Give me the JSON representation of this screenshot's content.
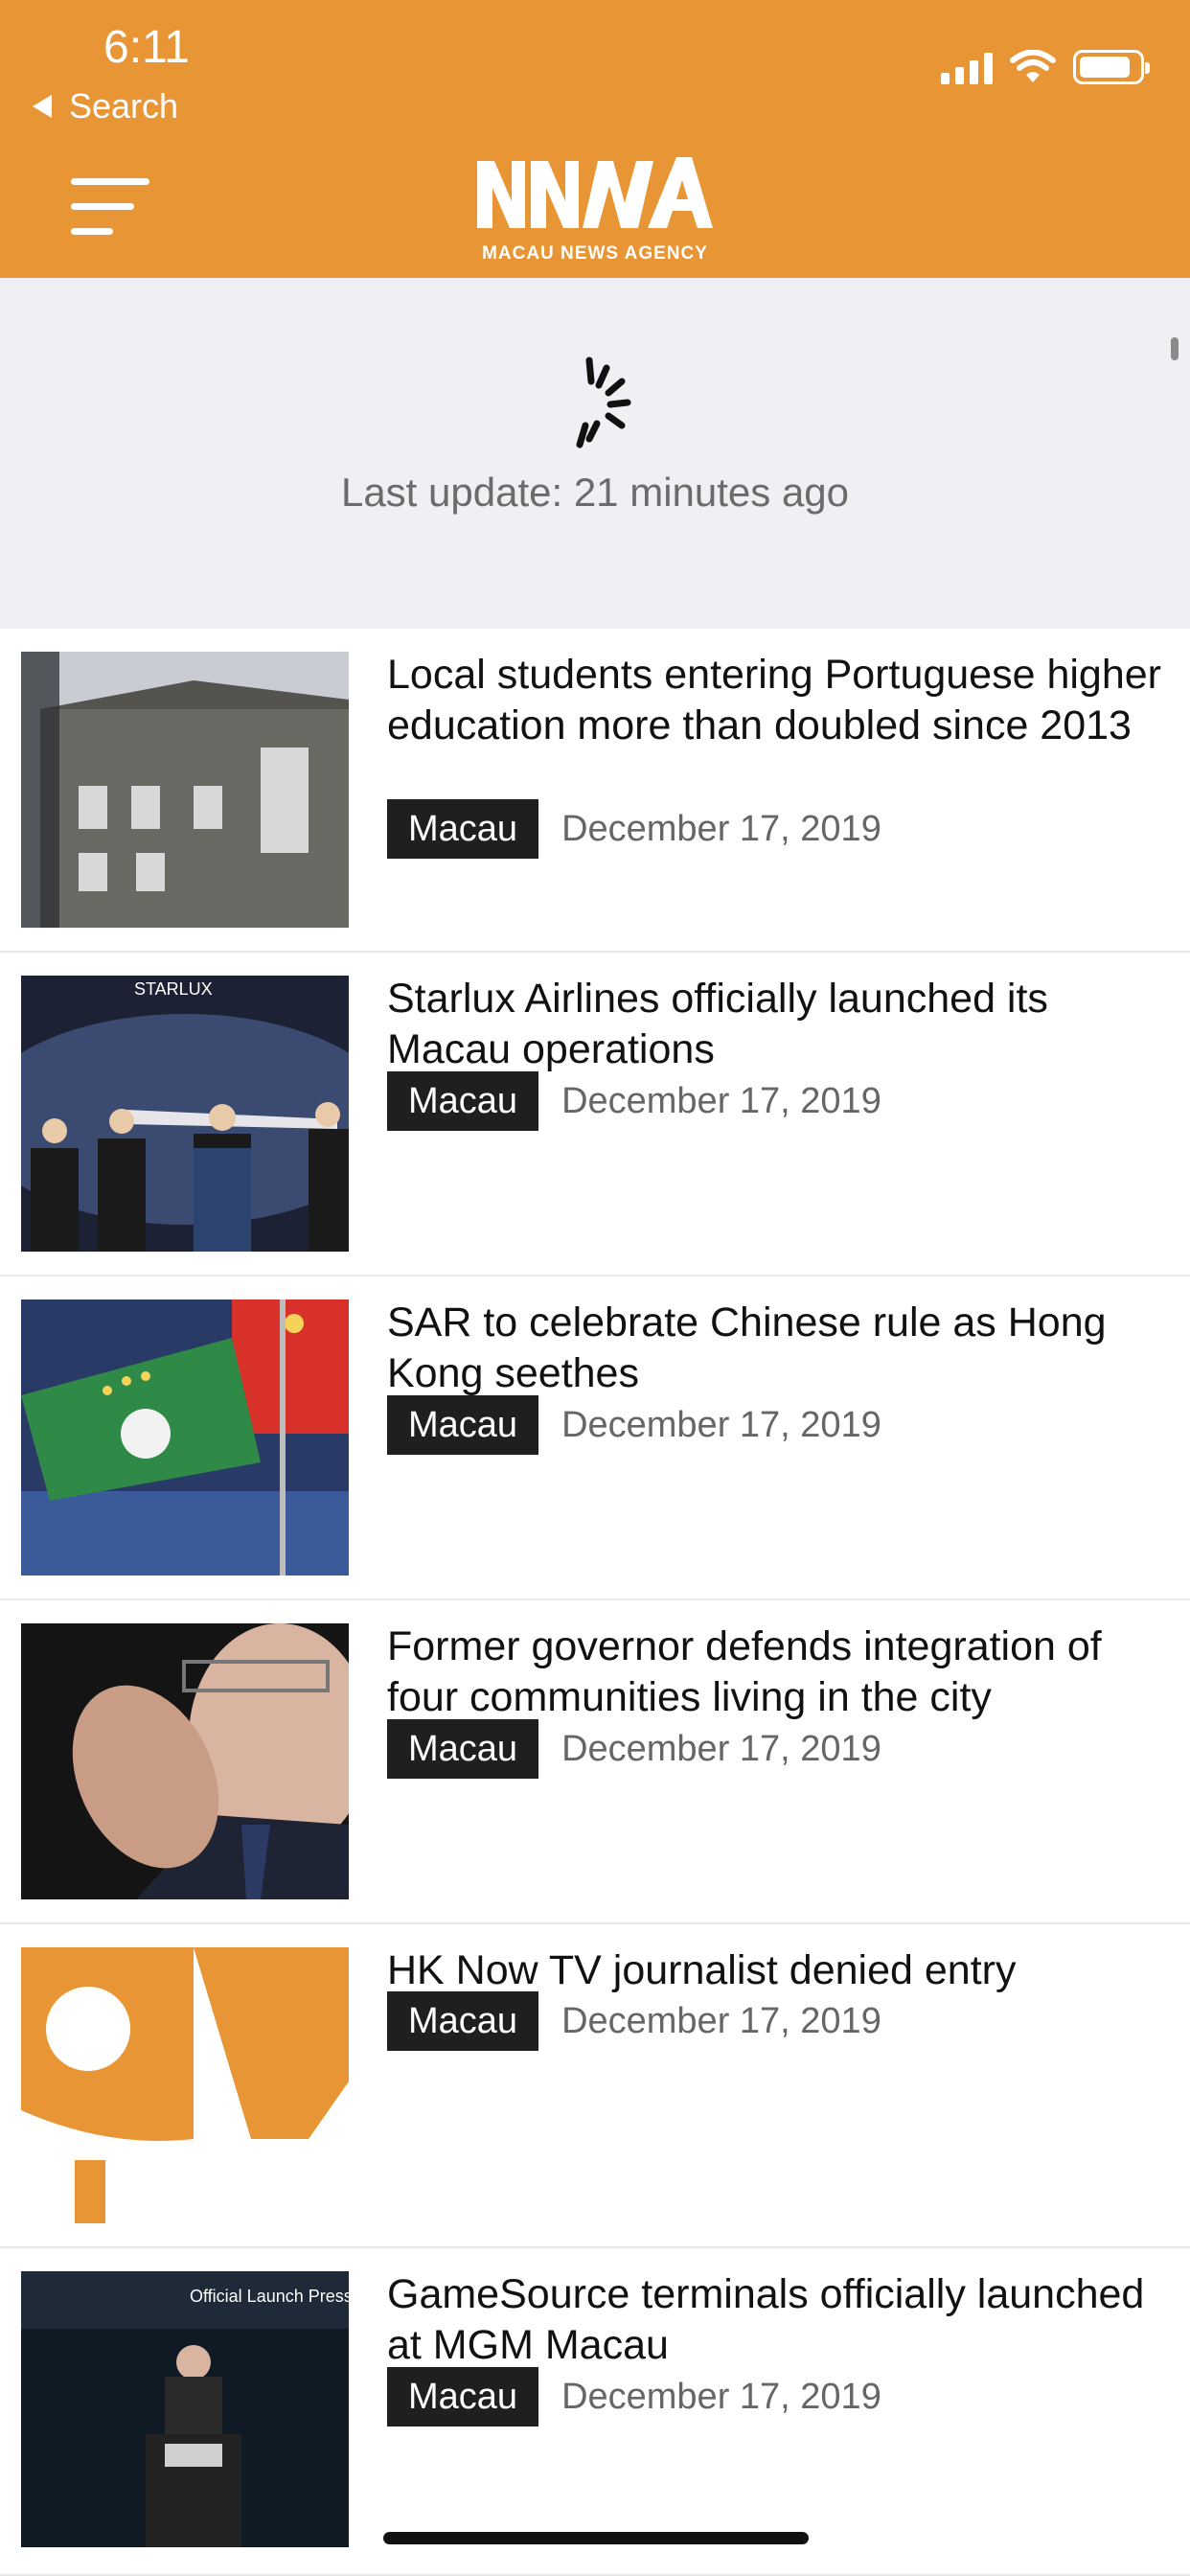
{
  "status": {
    "time": "6:11",
    "back_label": "Search"
  },
  "header": {
    "logo_tagline": "MACAU NEWS AGENCY",
    "brand_color": "#E89535"
  },
  "refresh": {
    "last_update": "Last update: 21 minutes ago"
  },
  "articles": [
    {
      "title": "Local students entering Portuguese higher education more than doubled since 2013",
      "category": "Macau",
      "date": "December 17, 2019",
      "image": "historic-building-photo"
    },
    {
      "title": "Starlux Airlines officially launched its Macau operations",
      "category": "Macau",
      "date": "December 17, 2019",
      "image": "starlux-launch-photo",
      "image_text": "STARLUX"
    },
    {
      "title": "SAR to celebrate Chinese rule as Hong Kong seethes",
      "category": "Macau",
      "date": "December 17, 2019",
      "image": "flags-photo"
    },
    {
      "title": "Former governor defends integration of four communities living in the city",
      "category": "Macau",
      "date": "December 17, 2019",
      "image": "governor-portrait-photo"
    },
    {
      "title": "HK Now TV journalist denied entry",
      "category": "Macau",
      "date": "December 17, 2019",
      "image": "orange-logo-placeholder"
    },
    {
      "title": "GameSource terminals officially launched at MGM Macau",
      "category": "Macau",
      "date": "December 17, 2019",
      "image": "launch-event-photo",
      "image_text": "Official Launch Press"
    }
  ]
}
